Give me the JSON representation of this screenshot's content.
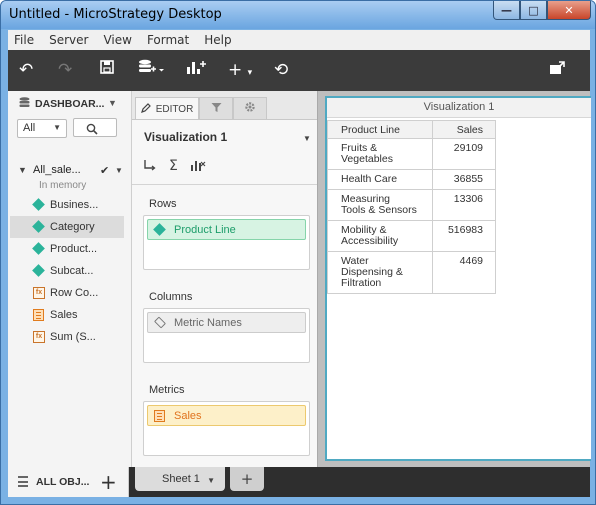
{
  "window": {
    "title": "Untitled - MicroStrategy Desktop",
    "minimize_glyph": "—",
    "maximize_glyph": "□",
    "close_glyph": "✕"
  },
  "menu": [
    "File",
    "Server",
    "View",
    "Format",
    "Help"
  ],
  "toolbar": {
    "undo": "↶",
    "redo": "↷",
    "save": "💾",
    "add_data": "☰",
    "add_viz": "❙",
    "insert": "+",
    "refresh": "⟲",
    "caret": "▾",
    "present": "▣"
  },
  "left_panel": {
    "title": "DASHBOAR...",
    "filter_value": "All",
    "dataset": {
      "name": "All_sale...",
      "status": "In memory"
    },
    "objects": [
      {
        "label": "Busines...",
        "type": "attribute"
      },
      {
        "label": "Category",
        "type": "attribute",
        "selected": true
      },
      {
        "label": "Product...",
        "type": "attribute"
      },
      {
        "label": "Subcat...",
        "type": "attribute"
      },
      {
        "label": "Row Co...",
        "type": "derived-metric"
      },
      {
        "label": "Sales",
        "type": "metric"
      },
      {
        "label": "Sum (S...",
        "type": "derived-metric"
      }
    ]
  },
  "editor": {
    "tabs": [
      "EDITOR",
      "filter",
      "format"
    ],
    "viz_name": "Visualization 1",
    "rows_label": "Rows",
    "rows_item": "Product Line",
    "columns_label": "Columns",
    "columns_item": "Metric Names",
    "metrics_label": "Metrics",
    "metrics_item": "Sales"
  },
  "visualization": {
    "title": "Visualization 1",
    "columns": [
      "Product Line",
      "Sales"
    ],
    "rows": [
      {
        "line1": "Fruits &",
        "line2": "Vegetables",
        "line3": "",
        "value": "29109"
      },
      {
        "line1": "Health Care",
        "line2": "",
        "line3": "",
        "value": "36855"
      },
      {
        "line1": "Measuring",
        "line2": "Tools & Sensors",
        "line3": "",
        "value": "13306"
      },
      {
        "line1": "Mobility &",
        "line2": "Accessibility",
        "line3": "",
        "value": "516983"
      },
      {
        "line1": "Water",
        "line2": "Dispensing &",
        "line3": "Filtration",
        "value": "4469"
      }
    ]
  },
  "bottom": {
    "all_objects": "ALL OBJ...",
    "sheet": "Sheet 1",
    "add": "+"
  }
}
